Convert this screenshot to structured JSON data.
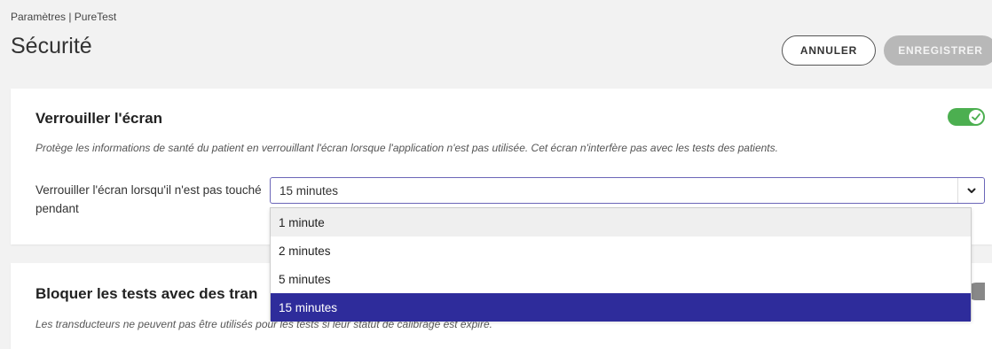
{
  "header": {
    "breadcrumb": "Paramètres | PureTest",
    "title": "Sécurité",
    "cancel_label": "ANNULER",
    "save_label": "ENREGISTRER"
  },
  "lock_screen": {
    "title": "Verrouiller l'écran",
    "description": "Protège les informations de santé du patient en verrouillant l'écran lorsque l'application n'est pas utilisée. Cet écran n'interfère pas avec les tests des patients.",
    "enabled": true,
    "timeout_label": "Verrouiller l'écran lorsqu'il n'est pas touché pendant",
    "timeout_value": "15 minutes",
    "timeout_options": [
      "1 minute",
      "2 minutes",
      "5 minutes",
      "15 minutes"
    ]
  },
  "block_tests": {
    "title": "Bloquer les tests avec des tran",
    "description": "Les transducteurs ne peuvent pas être utilisés pour les tests si leur statut de calibrage est expiré."
  },
  "colors": {
    "toggle_on": "#4caf50",
    "option_selected": "#2e2c9b",
    "select_border": "#6b66b8",
    "save_disabled": "#b8b8b8"
  },
  "icons": {
    "toggle_check": "check-icon",
    "select_chevron": "chevron-down-icon"
  }
}
